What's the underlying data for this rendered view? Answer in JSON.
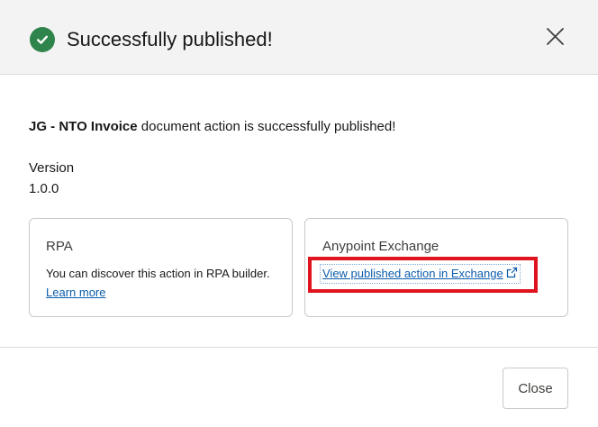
{
  "header": {
    "title": "Successfully published!",
    "status_icon": "check-circle-icon",
    "status_color": "#2e844a"
  },
  "body": {
    "document_name": "JG - NTO Invoice",
    "message_suffix": " document action is successfully published!",
    "version_label": "Version",
    "version_value": "1.0.0"
  },
  "cards": {
    "rpa": {
      "title": "RPA",
      "description": "You can discover this action in RPA builder.",
      "link": "Learn more"
    },
    "exchange": {
      "title": "Anypoint Exchange",
      "link": "View published action in Exchange",
      "link_icon": "external-link-icon"
    }
  },
  "footer": {
    "close_label": "Close"
  },
  "colors": {
    "link": "#0b5cab",
    "highlight": "#e0141e",
    "header_bg": "#f3f3f3"
  }
}
